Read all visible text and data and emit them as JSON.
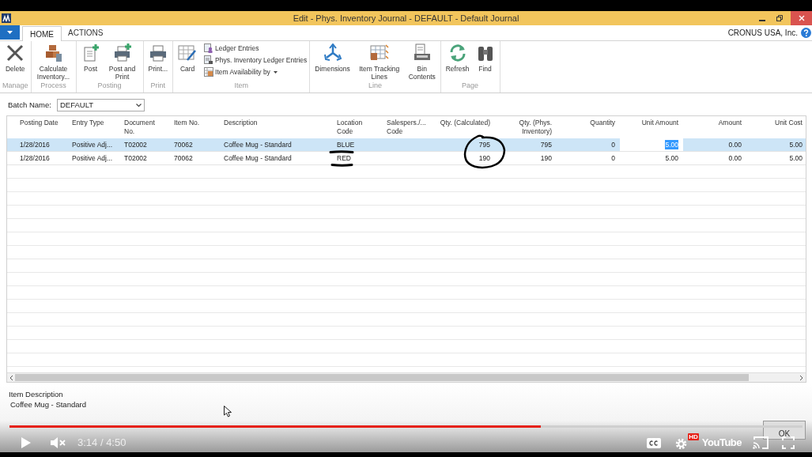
{
  "window": {
    "title": "Edit - Phys. Inventory Journal - DEFAULT - Default Journal"
  },
  "company": "CRONUS USA, Inc.",
  "tabs": [
    {
      "label": "HOME",
      "selected": true
    },
    {
      "label": "ACTIONS",
      "selected": false
    }
  ],
  "ribbon": [
    {
      "group": "Manage",
      "items": [
        {
          "label": "Delete",
          "kind": "large"
        }
      ]
    },
    {
      "group": "Process",
      "items": [
        {
          "label": "Calculate Inventory...",
          "kind": "large"
        }
      ]
    },
    {
      "group": "Posting",
      "items": [
        {
          "label": "Post",
          "kind": "large"
        },
        {
          "label": "Post and Print",
          "kind": "large"
        }
      ]
    },
    {
      "group": "Print",
      "items": [
        {
          "label": "Print...",
          "kind": "large"
        }
      ]
    },
    {
      "group": "Item",
      "items": [
        {
          "label": "Card",
          "kind": "large"
        },
        {
          "label": "Ledger Entries",
          "kind": "small"
        },
        {
          "label": "Phys. Inventory Ledger Entries",
          "kind": "small"
        },
        {
          "label": "Item Availability by",
          "kind": "small",
          "menu": true
        }
      ]
    },
    {
      "group": "Line",
      "items": [
        {
          "label": "Dimensions",
          "kind": "large"
        },
        {
          "label": "Item Tracking Lines",
          "kind": "large"
        },
        {
          "label": "Bin Contents",
          "kind": "large"
        }
      ]
    },
    {
      "group": "Page",
      "items": [
        {
          "label": "Refresh",
          "kind": "large"
        },
        {
          "label": "Find",
          "kind": "large"
        }
      ]
    }
  ],
  "batch": {
    "label": "Batch Name:",
    "value": "DEFAULT"
  },
  "table": {
    "columns": [
      "Posting Date",
      "Entry Type",
      "Document No.",
      "Item No.",
      "Description",
      "Location Code",
      "Salespers./... Code",
      "Qty. (Calculated)",
      "Qty. (Phys. Inventory)",
      "Quantity",
      "Unit Amount",
      "Amount",
      "Unit Cost"
    ],
    "rows": [
      {
        "selected": true,
        "editing": true,
        "posting_date": "1/28/2016",
        "entry_type": "Positive Adj...",
        "document_no": "T02002",
        "item_no": "70062",
        "description": "Coffee Mug - Standard",
        "location_code": "BLUE",
        "qty_calculated": "795",
        "qty_phys_inventory": "795",
        "quantity": "0",
        "unit_amount": "5.00",
        "amount": "0.00",
        "unit_cost": "5.00"
      },
      {
        "selected": false,
        "editing": false,
        "posting_date": "1/28/2016",
        "entry_type": "Positive Adj...",
        "document_no": "T02002",
        "item_no": "70062",
        "description": "Coffee Mug - Standard",
        "location_code": "RED",
        "qty_calculated": "190",
        "qty_phys_inventory": "190",
        "quantity": "0",
        "unit_amount": "5.00",
        "amount": "0.00",
        "unit_cost": "5.00"
      }
    ]
  },
  "details": {
    "label": "Item Description",
    "value": "Coffee Mug - Standard"
  },
  "dialog_button": {
    "label": "OK"
  },
  "player": {
    "level": 0.67,
    "time": "3:14 / 4:50",
    "hd_badge": "HD",
    "logo": "YouTube"
  }
}
